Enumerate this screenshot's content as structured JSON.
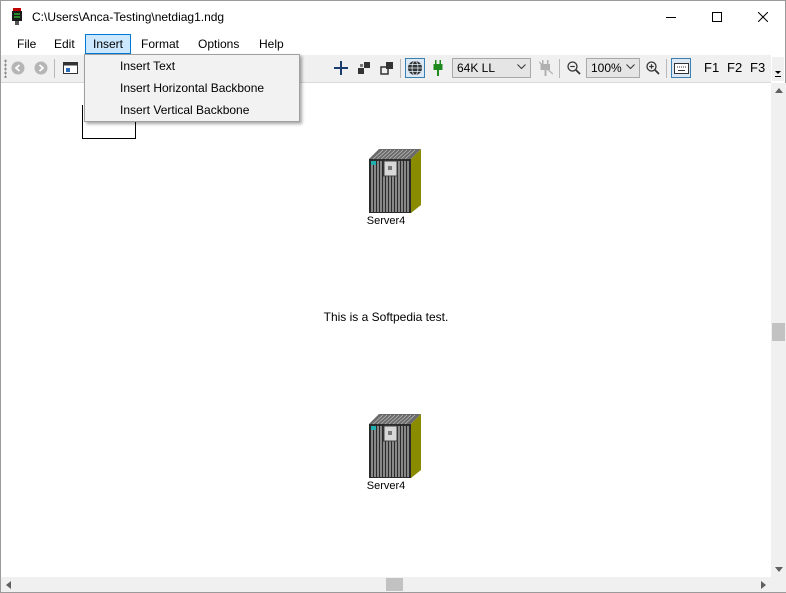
{
  "window": {
    "title": "C:\\Users\\Anca-Testing\\netdiag1.ndg",
    "buttons": [
      "minimize-icon",
      "maximize-icon",
      "close-icon"
    ]
  },
  "menubar": {
    "items": [
      {
        "label": "File"
      },
      {
        "label": "Edit"
      },
      {
        "label": "Insert",
        "open": true
      },
      {
        "label": "Format"
      },
      {
        "label": "Options"
      },
      {
        "label": "Help"
      }
    ]
  },
  "insert_menu": {
    "items": [
      {
        "label": "Insert Text"
      },
      {
        "label": "Insert Horizontal Backbone"
      },
      {
        "label": "Insert Vertical Backbone"
      }
    ]
  },
  "toolbar": {
    "icons": [
      "back-icon",
      "forward-icon",
      "window-icon",
      "crosshair-icon",
      "group-icon",
      "ungroup-icon",
      "globe-icon",
      "plug-icon",
      "disconnect-icon",
      "zoom-out-icon",
      "zoom-in-icon",
      "keyboard-icon"
    ],
    "line_type": "64K LL",
    "zoom": "100%",
    "fkeys": [
      "F1",
      "F2",
      "F3"
    ]
  },
  "canvas": {
    "nodes": [
      {
        "label": "Server4",
        "icon": "server-icon"
      },
      {
        "label": "Server4",
        "icon": "server-icon"
      }
    ],
    "text": "This is a Softpedia test."
  },
  "colors": {
    "menu_highlight": "#cce8ff",
    "menu_highlight_border": "#0078d7",
    "server_side": "#8b8b00",
    "server_front": "#2a2a2a"
  }
}
